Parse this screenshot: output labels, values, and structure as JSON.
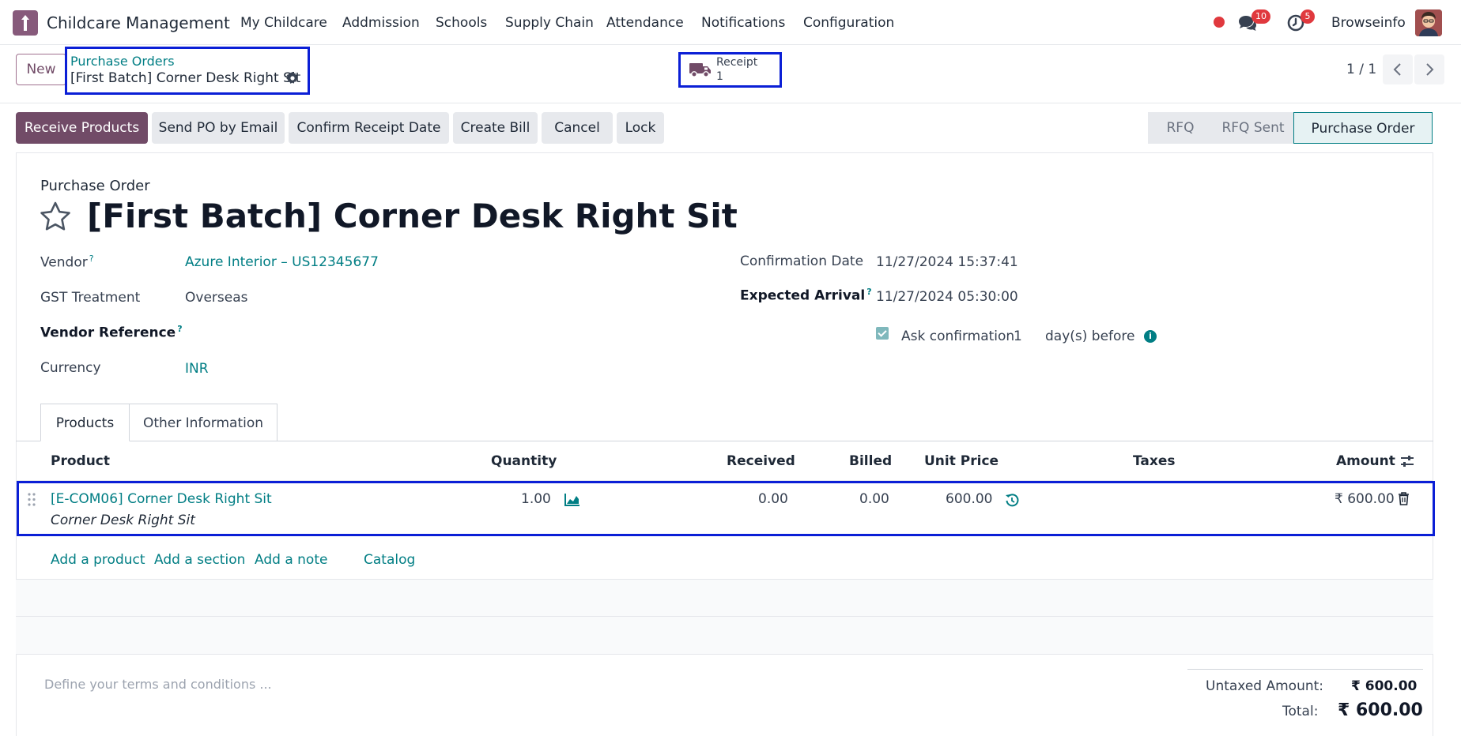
{
  "app": {
    "name": "Childcare Management"
  },
  "menu": [
    "My Childcare",
    "Addmission",
    "Schools",
    "Supply Chain",
    "Attendance",
    "Notifications",
    "Configuration"
  ],
  "systray": {
    "messages_count": "10",
    "activities_count": "5",
    "user_name": "Browseinfo"
  },
  "control": {
    "new_label": "New",
    "breadcrumb_parent": "Purchase Orders",
    "breadcrumb_current": "[First Batch] Corner Desk Right Sit",
    "receipt_label": "Receipt",
    "receipt_count": "1",
    "pager": "1 / 1"
  },
  "actions": [
    "Receive Products",
    "Send PO by Email",
    "Confirm Receipt Date",
    "Create Bill",
    "Cancel",
    "Lock"
  ],
  "stages": {
    "items": [
      "RFQ",
      "RFQ Sent",
      "Purchase Order"
    ],
    "active": "Purchase Order"
  },
  "form": {
    "doc_type": "Purchase Order",
    "title": "[First Batch] Corner Desk Right Sit",
    "vendor_label": "Vendor",
    "vendor_value": "Azure Interior – US12345677",
    "gst_label": "GST Treatment",
    "gst_value": "Overseas",
    "vendor_ref_label": "Vendor Reference",
    "currency_label": "Currency",
    "currency_value": "INR",
    "confirmation_date_label": "Confirmation Date",
    "confirmation_date_value": "11/27/2024 15:37:41",
    "expected_arrival_label": "Expected Arrival",
    "expected_arrival_value": "11/27/2024 05:30:00",
    "ask_confirmation_label": "Ask confirmation",
    "ask_confirmation_days": "1",
    "days_before_label": "day(s) before",
    "help_mark": "?"
  },
  "tabs": [
    "Products",
    "Other Information"
  ],
  "table": {
    "headers": {
      "product": "Product",
      "quantity": "Quantity",
      "received": "Received",
      "billed": "Billed",
      "unit_price": "Unit Price",
      "taxes": "Taxes",
      "amount": "Amount"
    },
    "rows": [
      {
        "product": "[E-COM06] Corner Desk Right Sit",
        "description": "Corner Desk Right Sit",
        "quantity": "1.00",
        "received": "0.00",
        "billed": "0.00",
        "unit_price": "600.00",
        "taxes": "",
        "amount": "₹ 600.00"
      }
    ],
    "add_links": [
      "Add a product",
      "Add a section",
      "Add a note",
      "Catalog"
    ]
  },
  "footer": {
    "terms_placeholder": "Define your terms and conditions ...",
    "untaxed_label": "Untaxed Amount:",
    "untaxed_value": "₹ 600.00",
    "total_label": "Total:",
    "total_value": "₹ 600.00"
  },
  "colors": {
    "brand": "#714b67",
    "link": "#017e84",
    "highlight": "#0b1fd6",
    "badge": "#e0393e"
  }
}
